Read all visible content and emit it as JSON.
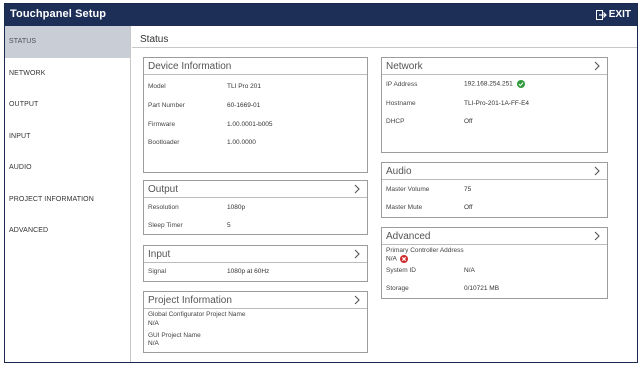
{
  "window": {
    "title": "Touchpanel Setup",
    "exit_label": "EXIT"
  },
  "sidebar": {
    "items": [
      {
        "label": "STATUS"
      },
      {
        "label": "NETWORK"
      },
      {
        "label": "OUTPUT"
      },
      {
        "label": "INPUT"
      },
      {
        "label": "AUDIO"
      },
      {
        "label": "PROJECT INFORMATION"
      },
      {
        "label": "ADVANCED"
      }
    ]
  },
  "main": {
    "title": "Status"
  },
  "device_info": {
    "title": "Device Information",
    "model_label": "Model",
    "model": "TLI Pro 201",
    "part_label": "Part Number",
    "part": "60-1669-01",
    "firmware_label": "Firmware",
    "firmware": "1.00.0001-b005",
    "bootloader_label": "Bootloader",
    "bootloader": "1.00.0000"
  },
  "output": {
    "title": "Output",
    "resolution_label": "Resolution",
    "resolution": "1080p",
    "sleep_label": "Sleep Timer",
    "sleep": "5"
  },
  "input": {
    "title": "Input",
    "signal_label": "Signal",
    "signal": "1080p at 60Hz"
  },
  "project": {
    "title": "Project Information",
    "gc_label": "Global Configurator Project Name",
    "gc_value": "N/A",
    "gui_label": "GUI Project Name",
    "gui_value": "N/A"
  },
  "network": {
    "title": "Network",
    "ip_label": "IP Address",
    "ip": "192.168.254.251",
    "host_label": "Hostname",
    "host": "TLI-Pro-201-1A-FF-E4",
    "dhcp_label": "DHCP",
    "dhcp": "Off"
  },
  "audio": {
    "title": "Audio",
    "volume_label": "Master Volume",
    "volume": "75",
    "mute_label": "Master Mute",
    "mute": "Off"
  },
  "advanced": {
    "title": "Advanced",
    "controller_label": "Primary Controller Address",
    "controller": "N/A",
    "system_label": "System ID",
    "system": "N/A",
    "storage_label": "Storage",
    "storage": "0/10721 MB"
  },
  "colors": {
    "titlebar": "#1e2f57",
    "active_nav": "#c9ced6",
    "ok": "#2e9a3a",
    "error": "#cf2b2b"
  },
  "icons": {
    "exit": "exit-icon",
    "chevron": "chevron-right-icon",
    "ok": "check-circle-icon",
    "error": "x-circle-icon"
  }
}
